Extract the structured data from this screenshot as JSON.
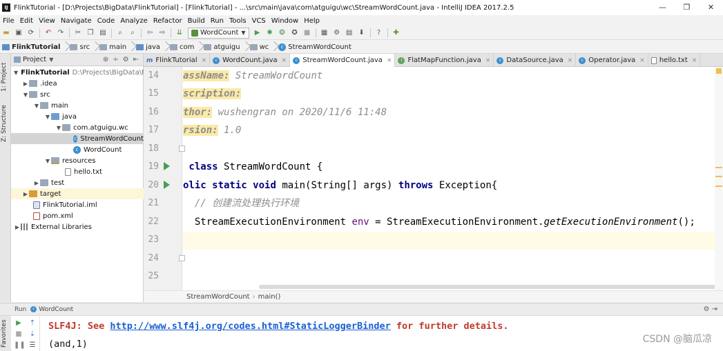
{
  "window": {
    "title": "FlinkTutorial - [D:\\Projects\\BigData\\FlinkTutorial] - [FlinkTutorial] - ...\\src\\main\\java\\com\\atguigu\\wc\\StreamWordCount.java - IntelliJ IDEA 2017.2.5",
    "minimize": "—",
    "maximize": "❐",
    "close": "✕"
  },
  "menu": [
    "File",
    "Edit",
    "View",
    "Navigate",
    "Code",
    "Analyze",
    "Refactor",
    "Build",
    "Run",
    "Tools",
    "VCS",
    "Window",
    "Help"
  ],
  "toolbar": {
    "run_config": "WordCount"
  },
  "breadcrumbs": [
    "FlinkTutorial",
    "src",
    "main",
    "java",
    "com",
    "atguigu",
    "wc",
    "StreamWordCount"
  ],
  "side_tabs": {
    "project": "1: Project",
    "structure": "Z: Structure",
    "favorites": "Favorites"
  },
  "project_panel": {
    "title": "Project",
    "tree": [
      {
        "label": "FlinkTutorial",
        "path": "D:\\Projects\\BigData\\Fl"
      },
      {
        "label": ".idea"
      },
      {
        "label": "src"
      },
      {
        "label": "main"
      },
      {
        "label": "java"
      },
      {
        "label": "com.atguigu.wc"
      },
      {
        "label": "StreamWordCount"
      },
      {
        "label": "WordCount"
      },
      {
        "label": "resources"
      },
      {
        "label": "hello.txt"
      },
      {
        "label": "test"
      },
      {
        "label": "target"
      },
      {
        "label": "FlinkTutorial.iml"
      },
      {
        "label": "pom.xml"
      },
      {
        "label": "External Libraries"
      }
    ]
  },
  "tabs": [
    "FlinkTutorial",
    "WordCount.java",
    "StreamWordCount.java",
    "FlatMapFunction.java",
    "DataSource.java",
    "Operator.java",
    "hello.txt"
  ],
  "editor": {
    "line_numbers": [
      "14",
      "15",
      "16",
      "17",
      "18",
      "19",
      "20",
      "21",
      "22",
      "23",
      "24",
      "25"
    ],
    "lines": {
      "l14_tag": "assName:",
      "l14_val": " StreamWordCount",
      "l15_tag": "scription:",
      "l16_tag": "thor:",
      "l16_val": " wushengran on 2020/11/6 11:48",
      "l17_tag": "rsion:",
      "l17_val": " 1.0",
      "l19_kw": " class",
      "l19_rest": " StreamWordCount {",
      "l20_kw1": "olic",
      "l20_kw2": " static",
      "l20_kw3": " void",
      "l20_mid": " main(String[] args)",
      "l20_kw4": " throws",
      "l20_rest": " Exception{",
      "l21_comment": "  // 创建流处理执行环境",
      "l22_type": "  StreamExecutionEnvironment ",
      "l22_var": "env",
      "l22_eq": " = StreamExecutionEnvironment.",
      "l22_call": "getExecutionEnvironment",
      "l22_end": "();"
    },
    "breadcrumb": [
      "StreamWordCount",
      "main()"
    ]
  },
  "run_panel": {
    "run_label": "Run",
    "config": "WordCount",
    "console": {
      "line1_prefix": "SLF4J: See ",
      "line1_link": "http://www.slf4j.org/codes.html#StaticLoggerBinder",
      "line1_suffix": " for further details.",
      "line2": "(and,1)"
    }
  },
  "watermark": "CSDN @脑瓜凉"
}
